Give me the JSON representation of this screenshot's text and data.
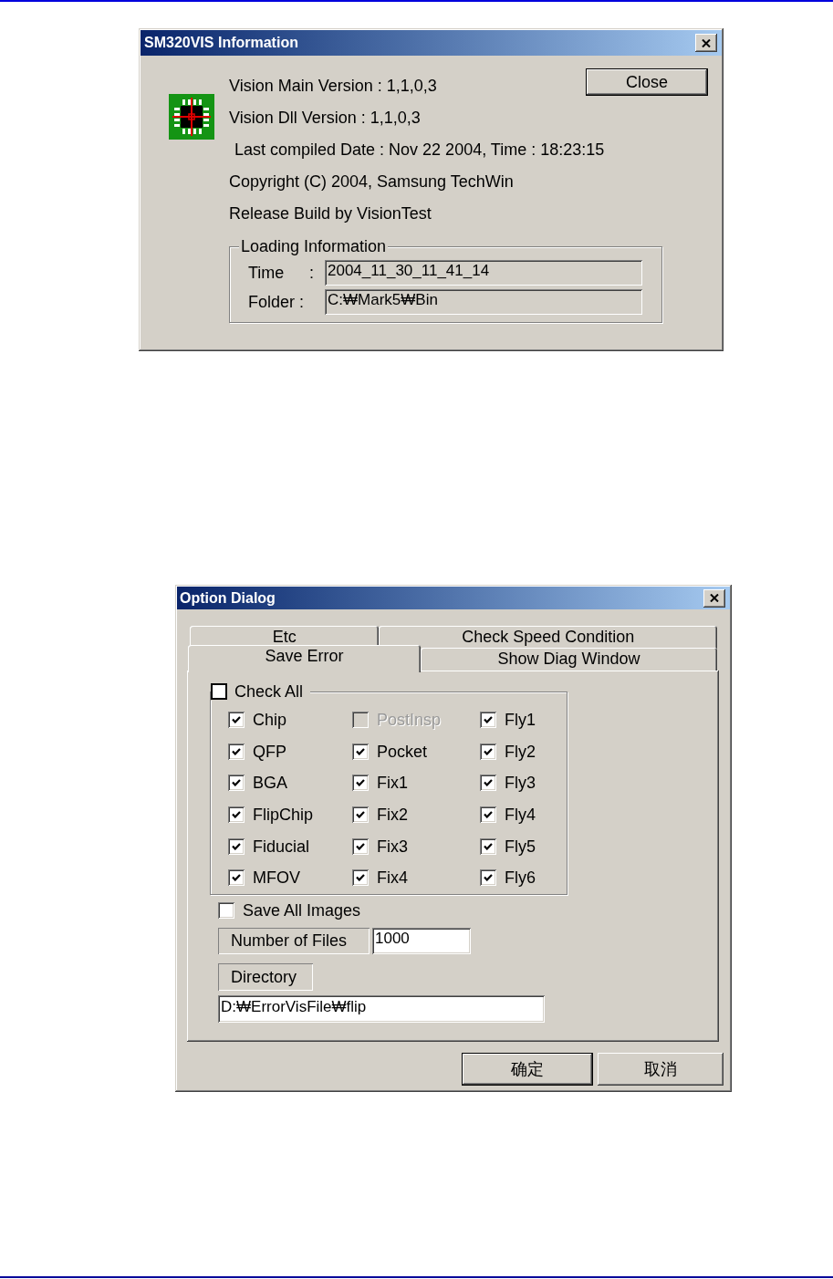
{
  "info_dialog": {
    "title": "SM320VIS Information",
    "close_button": "Close",
    "lines": [
      {
        "text": "Vision Main Version : 1,1,0,3",
        "indented": false
      },
      {
        "text": "Vision Dll Version : 1,1,0,3",
        "indented": false
      },
      {
        "text": "Last compiled Date : Nov 22 2004, Time : 18:23:15",
        "indented": true
      },
      {
        "text": "Copyright (C) 2004, Samsung TechWin",
        "indented": false
      },
      {
        "text": "Release Build by VisionTest",
        "indented": false
      }
    ],
    "loading_information": {
      "legend": "Loading Information",
      "fields": [
        {
          "label": "Time",
          "separator": ":",
          "value": "2004_11_30_11_41_14"
        },
        {
          "label": "Folder :",
          "value": "C:₩Mark5₩Bin"
        }
      ]
    }
  },
  "option_dialog": {
    "title": "Option Dialog",
    "tab_rows": [
      {
        "tabs": [
          {
            "label": "Etc",
            "selected": false
          },
          {
            "label": "Check Speed Condition",
            "selected": false
          }
        ]
      },
      {
        "tabs": [
          {
            "label": "Save Error",
            "selected": true
          },
          {
            "label": "Show Diag Window",
            "selected": false
          }
        ]
      }
    ],
    "check_all": {
      "label": "Check All",
      "checked": false
    },
    "check_items": [
      {
        "label": "Chip",
        "checked": true,
        "disabled": false
      },
      {
        "label": "PostInsp",
        "checked": false,
        "disabled": true
      },
      {
        "label": "Fly1",
        "checked": true,
        "disabled": false
      },
      {
        "label": "QFP",
        "checked": true,
        "disabled": false
      },
      {
        "label": "Pocket",
        "checked": true,
        "disabled": false
      },
      {
        "label": "Fly2",
        "checked": true,
        "disabled": false
      },
      {
        "label": "BGA",
        "checked": true,
        "disabled": false
      },
      {
        "label": "Fix1",
        "checked": true,
        "disabled": false
      },
      {
        "label": "Fly3",
        "checked": true,
        "disabled": false
      },
      {
        "label": "FlipChip",
        "checked": true,
        "disabled": false
      },
      {
        "label": "Fix2",
        "checked": true,
        "disabled": false
      },
      {
        "label": "Fly4",
        "checked": true,
        "disabled": false
      },
      {
        "label": "Fiducial",
        "checked": true,
        "disabled": false
      },
      {
        "label": "Fix3",
        "checked": true,
        "disabled": false
      },
      {
        "label": "Fly5",
        "checked": true,
        "disabled": false
      },
      {
        "label": "MFOV",
        "checked": true,
        "disabled": false
      },
      {
        "label": "Fix4",
        "checked": true,
        "disabled": false
      },
      {
        "label": "Fly6",
        "checked": true,
        "disabled": false
      }
    ],
    "save_all_images": {
      "label": "Save All Images",
      "checked": false
    },
    "number_of_files": {
      "label": "Number of Files",
      "value": "1000"
    },
    "directory": {
      "label": "Directory",
      "value": "D:₩ErrorVisFile₩flip"
    },
    "buttons": [
      {
        "label": "确定",
        "default": true
      },
      {
        "label": "取消",
        "default": false
      }
    ]
  }
}
